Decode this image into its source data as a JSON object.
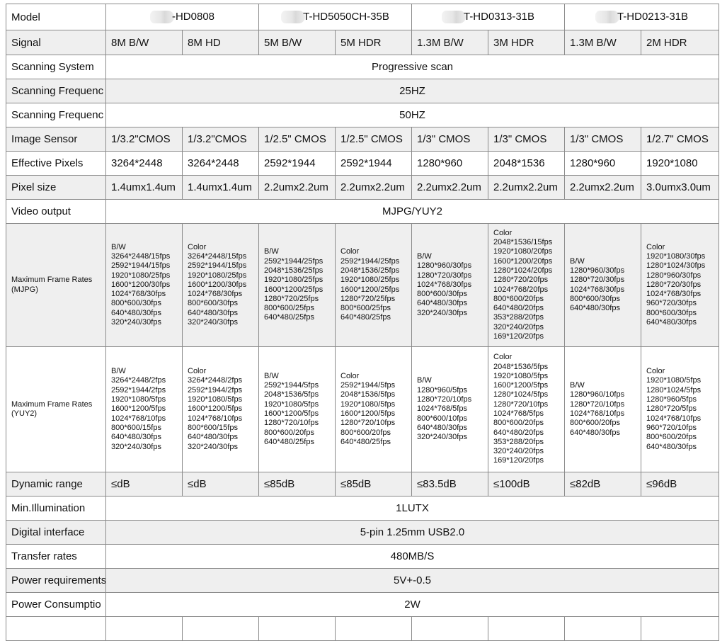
{
  "table": {
    "models": [
      {
        "name": "-HD0808",
        "span": 2
      },
      {
        "name": "T-HD5050CH-35B",
        "span": 2
      },
      {
        "name": "T-HD0313-31B",
        "span": 2
      },
      {
        "name": "T-HD0213-31B",
        "span": 2
      }
    ],
    "labels": {
      "model": "Model",
      "signal": "Signal",
      "scanning_system": "Scanning System",
      "scanning_frequency_1": "Scanning Frequenc",
      "scanning_frequency_2": "Scanning Frequenc",
      "image_sensor": "Image Sensor",
      "effective_pixels": "Effective Pixels",
      "pixel_size": "Pixel size",
      "video_output": "Video output",
      "max_frame_rates_mjpg_1": "Maximum Frame Rates",
      "max_frame_rates_mjpg_2": "(MJPG)",
      "max_frame_rates_yuy2_1": "Maximum Frame Rates",
      "max_frame_rates_yuy2_2": "(YUY2)",
      "dynamic_range": "Dynamic range",
      "min_illumination": "Min.Illumination",
      "digital_interface": "Digital interface",
      "transfer_rates": "Transfer rates",
      "power_requirements": "Power requirements",
      "power_consumption": "Power Consumptio"
    },
    "signal": [
      "8M B/W",
      "8M HD",
      "5M B/W",
      "5M HDR",
      "1.3M B/W",
      "3M HDR",
      "1.3M B/W",
      "2M HDR"
    ],
    "scanning_system": "Progressive scan",
    "scanning_frequency_1": "25HZ",
    "scanning_frequency_2": "50HZ",
    "image_sensor": [
      "1/3.2\"CMOS",
      "1/3.2\"CMOS",
      "1/2.5\" CMOS",
      "1/2.5\" CMOS",
      "1/3\" CMOS",
      "1/3\" CMOS",
      "1/3\" CMOS",
      "1/2.7\" CMOS"
    ],
    "effective_pixels": [
      "3264*2448",
      "3264*2448",
      "2592*1944",
      "2592*1944",
      "1280*960",
      "2048*1536",
      "1280*960",
      "1920*1080"
    ],
    "pixel_size": [
      "1.4umx1.4um",
      "1.4umx1.4um",
      "2.2umx2.2um",
      "2.2umx2.2um",
      "2.2umx2.2um",
      "2.2umx2.2um",
      "2.2umx2.2um",
      "3.0umx3.0um"
    ],
    "video_output": "MJPG/YUY2",
    "max_frame_rates_mjpg": [
      [
        "B/W",
        "3264*2448/15fps",
        "2592*1944/15fps",
        "1920*1080/25fps",
        "1600*1200/30fps",
        "1024*768/30fps",
        "800*600/30fps",
        "640*480/30fps",
        "320*240/30fps"
      ],
      [
        "Color",
        "3264*2448/15fps",
        "2592*1944/15fps",
        "1920*1080/25fps",
        "1600*1200/30fps",
        "1024*768/30fps",
        "800*600/30fps",
        "640*480/30fps",
        "320*240/30fps"
      ],
      [
        "B/W",
        "2592*1944/25fps",
        "2048*1536/25fps",
        "1920*1080/25fps",
        "1600*1200/25fps",
        "1280*720/25fps",
        "800*600/25fps",
        "640*480/25fps"
      ],
      [
        "Color",
        "2592*1944/25fps",
        "2048*1536/25fps",
        "1920*1080/25fps",
        "1600*1200/25fps",
        "1280*720/25fps",
        "800*600/25fps",
        "640*480/25fps"
      ],
      [
        "B/W",
        "1280*960/30fps",
        "1280*720/30fps",
        "1024*768/30fps",
        "800*600/30fps",
        "640*480/30fps",
        "320*240/30fps"
      ],
      [
        "Color",
        "2048*1536/15fps",
        "1920*1080/20fps",
        "1600*1200/20fps",
        "1280*1024/20fps",
        "1280*720/20fps",
        "1024*768/20fps",
        "800*600/20fps",
        "640*480/20fps",
        "353*288/20fps",
        "320*240/20fps",
        "169*120/20fps"
      ],
      [
        "B/W",
        "1280*960/30fps",
        "1280*720/30fps",
        "1024*768/30fps",
        "800*600/30fps",
        "640*480/30fps"
      ],
      [
        "Color",
        "1920*1080/30fps",
        "1280*1024/30fps",
        "1280*960/30fps",
        "1280*720/30fps",
        "1024*768/30fps",
        "960*720/30fps",
        "800*600/30fps",
        "640*480/30fps"
      ]
    ],
    "max_frame_rates_yuy2": [
      [
        "B/W",
        "3264*2448/2fps",
        "2592*1944/2fps",
        "1920*1080/5fps",
        "1600*1200/5fps",
        "1024*768/10fps",
        "800*600/15fps",
        "640*480/30fps",
        "320*240/30fps"
      ],
      [
        "Color",
        "3264*2448/2fps",
        "2592*1944/2fps",
        "1920*1080/5fps",
        "1600*1200/5fps",
        "1024*768/10fps",
        "800*600/15fps",
        "640*480/30fps",
        "320*240/30fps"
      ],
      [
        "B/W",
        "2592*1944/5fps",
        "2048*1536/5fps",
        "1920*1080/5fps",
        "1600*1200/5fps",
        "1280*720/10fps",
        "800*600/20fps",
        "640*480/25fps"
      ],
      [
        "Color",
        "2592*1944/5fps",
        "2048*1536/5fps",
        "1920*1080/5fps",
        "1600*1200/5fps",
        "1280*720/10fps",
        "800*600/20fps",
        "640*480/25fps"
      ],
      [
        "B/W",
        "1280*960/5fps",
        "1280*720/10fps",
        "1024*768/5fps",
        "800*600/10fps",
        "640*480/30fps",
        "320*240/30fps"
      ],
      [
        "Color",
        "2048*1536/5fps",
        "1920*1080/5fps",
        "1600*1200/5fps",
        "1280*1024/5fps",
        "1280*720/10fps",
        "1024*768/5fps",
        "800*600/20fps",
        "640*480/20fps",
        "353*288/20fps",
        "320*240/20fps",
        "169*120/20fps"
      ],
      [
        "B/W",
        "1280*960/10fps",
        "1280*720/10fps",
        "1024*768/10fps",
        "800*600/20fps",
        "640*480/30fps"
      ],
      [
        "Color",
        "1920*1080/5fps",
        "1280*1024/5fps",
        "1280*960/5fps",
        "1280*720/5fps",
        "1024*768/10fps",
        "960*720/10fps",
        "800*600/20fps",
        "640*480/30fps"
      ]
    ],
    "dynamic_range": [
      "≤dB",
      "≤dB",
      "≤85dB",
      "≤85dB",
      "≤83.5dB",
      "≤100dB",
      "≤82dB",
      "≤96dB"
    ],
    "min_illumination": "1LUTX",
    "digital_interface": "5-pin 1.25mm USB2.0",
    "transfer_rates": "480MB/S",
    "power_requirements": "5V+-0.5",
    "power_consumption": "2W"
  }
}
